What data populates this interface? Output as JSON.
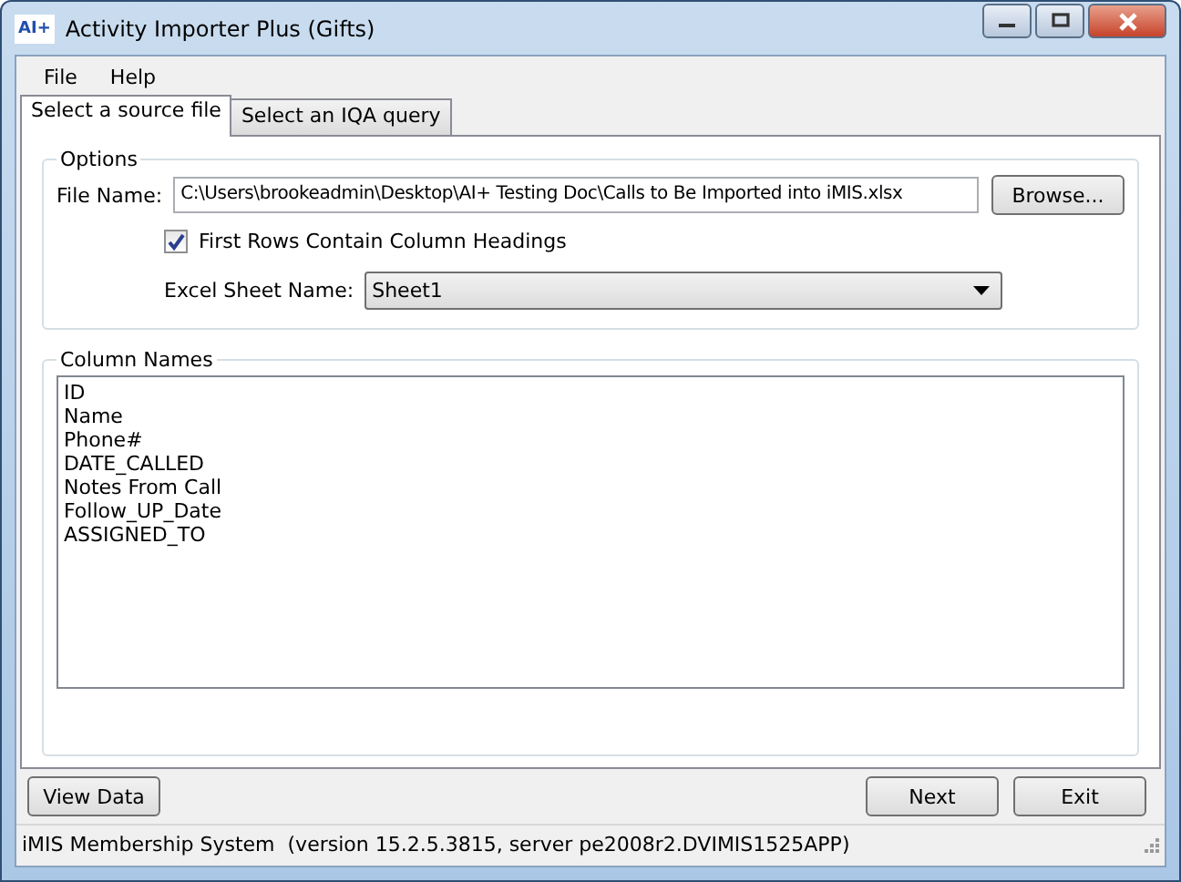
{
  "window": {
    "logo": "AI+",
    "title": "Activity Importer Plus (Gifts)"
  },
  "menu": [
    "File",
    "Help"
  ],
  "tabs": [
    {
      "label": "Select a source file",
      "selected": true
    },
    {
      "label": "Select an IQA query",
      "selected": false
    }
  ],
  "options": {
    "legend": "Options",
    "file_label": "File Name:",
    "file_value": "C:\\Users\\brookeadmin\\Desktop\\AI+ Testing Doc\\Calls to Be Imported into iMIS.xlsx",
    "browse": "Browse...",
    "headings": {
      "label": "First Rows Contain Column Headings",
      "checked": true
    },
    "sheet_label": "Excel Sheet Name:",
    "sheet_value": "Sheet1"
  },
  "columns": {
    "legend": "Column Names",
    "items": [
      "ID",
      "Name",
      "Phone#",
      "DATE_CALLED",
      "Notes From Call",
      "Follow_UP_Date",
      "ASSIGNED_TO"
    ]
  },
  "buttons": {
    "view": "View Data",
    "next": "Next",
    "exit": "Exit"
  },
  "status_bar": "iMIS Membership System  (version 15.2.5.3815, server pe2008r2.DVIMIS1525APP)"
}
